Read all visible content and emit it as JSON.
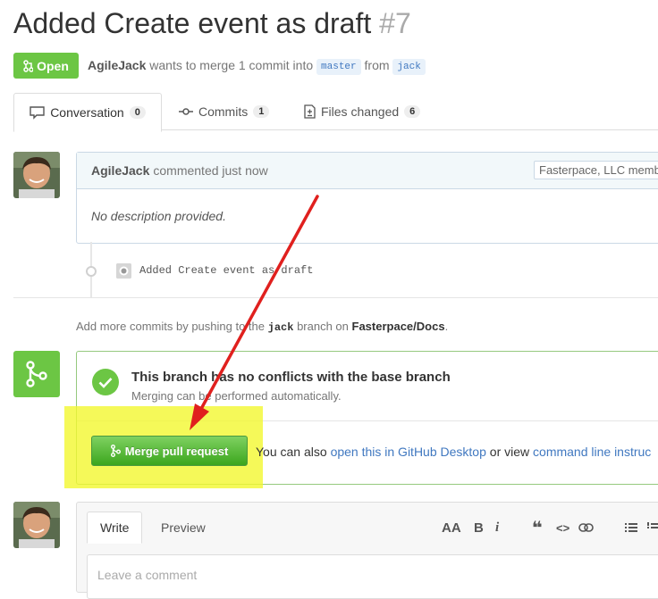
{
  "pr": {
    "title": "Added Create event as draft",
    "number": "#7",
    "state_label": "Open",
    "author": "AgileJack",
    "merge_text": "wants to merge 1 commit into",
    "base_branch": "master",
    "from_text": "from",
    "head_branch": "jack"
  },
  "tabs": [
    {
      "label": "Conversation",
      "count": "0"
    },
    {
      "label": "Commits",
      "count": "1"
    },
    {
      "label": "Files changed",
      "count": "6"
    }
  ],
  "comment": {
    "author": "AgileJack",
    "action": "commented just now",
    "member_badge": "Fasterpace, LLC memb",
    "body": "No description provided."
  },
  "commit": {
    "message": "Added Create event as draft"
  },
  "hint": {
    "prefix": "Add more commits by pushing to the",
    "branch": "jack",
    "middle": "branch on",
    "repo": "Fasterpace/Docs",
    "suffix": "."
  },
  "merge": {
    "heading": "This branch has no conflicts with the base branch",
    "subtext": "Merging can be performed automatically.",
    "button_label": "Merge pull request",
    "also_text": "You can also",
    "desktop_link": "open this in GitHub Desktop",
    "or_view": "or view",
    "cli_link": "command line instruc"
  },
  "editor": {
    "write_tab": "Write",
    "preview_tab": "Preview",
    "placeholder": "Leave a comment",
    "toolbar": [
      "AA",
      "B",
      "i",
      "❝",
      "<>",
      "link",
      "list"
    ]
  },
  "colors": {
    "green": "#6cc644",
    "link": "#4078c0",
    "highlight": "#f2f830",
    "arrow": "#e0201e"
  }
}
